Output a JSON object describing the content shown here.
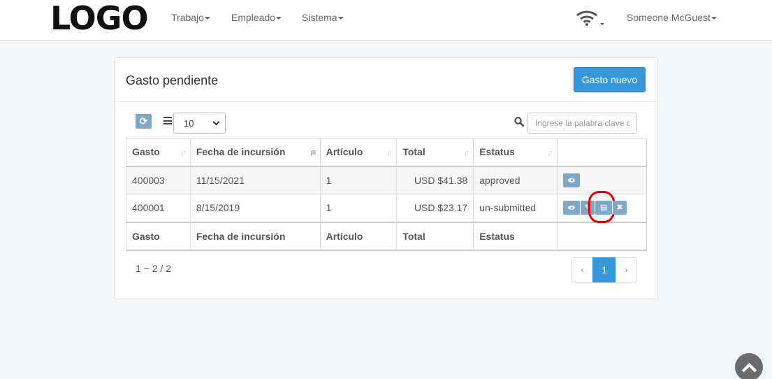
{
  "navbar": {
    "logo": "LOGO",
    "menu": [
      {
        "label": "Trabajo"
      },
      {
        "label": "Empleado"
      },
      {
        "label": "Sistema"
      }
    ],
    "user": "Someone McGuest"
  },
  "panel": {
    "title": "Gasto pendiente",
    "new_button": "Gasto nuevo"
  },
  "toolbar": {
    "page_size": "10",
    "search_placeholder": "Ingrese la palabra clave d"
  },
  "table": {
    "headers": [
      "Gasto",
      "Fecha de incursión",
      "Artículo",
      "Total",
      "Estatus"
    ],
    "rows": [
      {
        "gasto": "400003",
        "fecha": "11/15/2021",
        "articulo": "1",
        "total": "USD $41.38",
        "estatus": "approved"
      },
      {
        "gasto": "400001",
        "fecha": "8/15/2019",
        "articulo": "1",
        "total": "USD $23.17",
        "estatus": "un-submitted"
      }
    ],
    "footers": [
      "Gasto",
      "Fecha de incursión",
      "Artículo",
      "Total",
      "Estatus"
    ]
  },
  "pagination": {
    "info": "1 ~ 2 / 2",
    "prev": "‹",
    "current": "1",
    "next": "›"
  },
  "colors": {
    "primary": "#3498db",
    "action_button": "#7fa7c7",
    "highlight": "#e30000"
  }
}
